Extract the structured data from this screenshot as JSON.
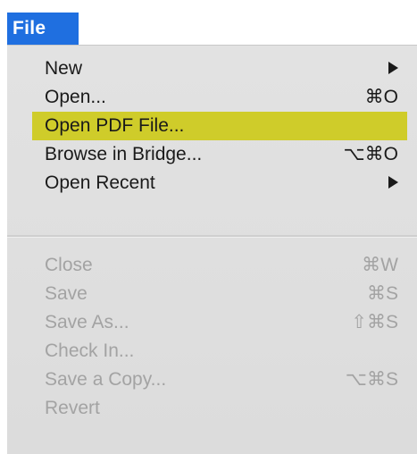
{
  "menubar": {
    "file_label": "File"
  },
  "menu": {
    "items": [
      {
        "label": "New",
        "shortcut": "",
        "submenu": true,
        "enabled": true,
        "highlighted": false
      },
      {
        "label": "Open...",
        "shortcut": "⌘O",
        "submenu": false,
        "enabled": true,
        "highlighted": false
      },
      {
        "label": "Open PDF File...",
        "shortcut": "",
        "submenu": false,
        "enabled": true,
        "highlighted": true
      },
      {
        "label": "Browse in Bridge...",
        "shortcut": "⌥⌘O",
        "submenu": false,
        "enabled": true,
        "highlighted": false
      },
      {
        "label": "Open Recent",
        "shortcut": "",
        "submenu": true,
        "enabled": true,
        "highlighted": false
      },
      {
        "label": "Close",
        "shortcut": "⌘W",
        "submenu": false,
        "enabled": false,
        "highlighted": false
      },
      {
        "label": "Save",
        "shortcut": "⌘S",
        "submenu": false,
        "enabled": false,
        "highlighted": false
      },
      {
        "label": "Save As...",
        "shortcut": "⇧⌘S",
        "submenu": false,
        "enabled": false,
        "highlighted": false
      },
      {
        "label": "Check In...",
        "shortcut": "",
        "submenu": false,
        "enabled": false,
        "highlighted": false
      },
      {
        "label": "Save a Copy...",
        "shortcut": "⌥⌘S",
        "submenu": false,
        "enabled": false,
        "highlighted": false
      },
      {
        "label": "Revert",
        "shortcut": "",
        "submenu": false,
        "enabled": false,
        "highlighted": false
      }
    ],
    "colors": {
      "menubar_active": "#1f6fe0",
      "highlight": "#cfcc2a",
      "menu_bg": "#dedede",
      "text_enabled": "#1a1a1a",
      "text_disabled": "#a3a3a3"
    }
  }
}
